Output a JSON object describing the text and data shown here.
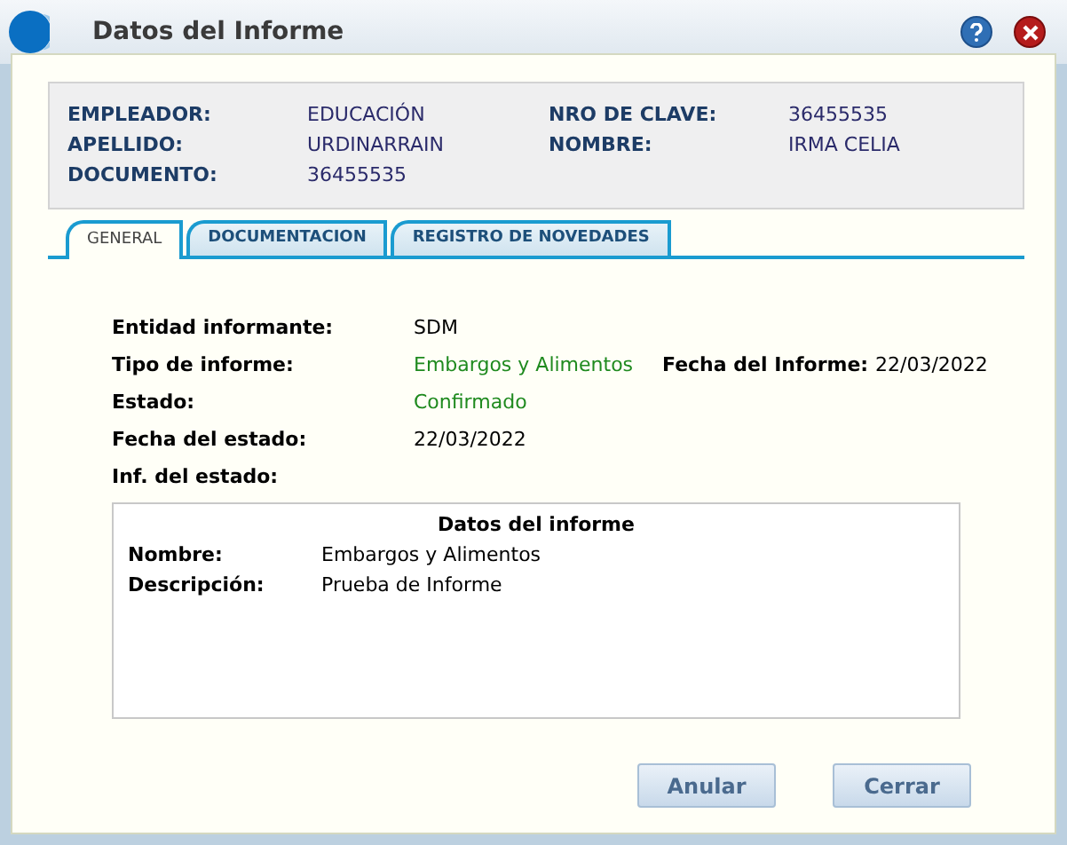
{
  "window": {
    "title": "Datos del Informe"
  },
  "header": [
    {
      "label": "EMPLEADOR:",
      "value": "EDUCACIÓN"
    },
    {
      "label": "NRO DE CLAVE:",
      "value": "36455535"
    },
    {
      "label": "APELLIDO:",
      "value": "URDINARRAIN"
    },
    {
      "label": "NOMBRE:",
      "value": "IRMA CELIA"
    },
    {
      "label": "DOCUMENTO:",
      "value": "36455535"
    }
  ],
  "tabs": [
    {
      "label": "GENERAL",
      "selected": true
    },
    {
      "label": "DOCUMENTACION",
      "selected": false
    },
    {
      "label": "REGISTRO DE NOVEDADES",
      "selected": false
    }
  ],
  "fields": [
    [
      {
        "label": "Entidad informante:",
        "value": "SDM",
        "color": "#000000"
      }
    ],
    [
      {
        "label": "Tipo de informe:",
        "value": "Embargos y Alimentos",
        "color": "#1f8a1f"
      },
      {
        "label": "Fecha del Informe:",
        "value": "22/03/2022",
        "color": "#000000"
      }
    ],
    [
      {
        "label": "Estado:",
        "value": "Confirmado",
        "color": "#1f8a1f"
      }
    ],
    [
      {
        "label": "Fecha del estado:",
        "value": "22/03/2022",
        "color": "#000000"
      }
    ],
    [
      {
        "label": "Inf. del estado:"
      }
    ]
  ],
  "details": {
    "title": "Datos del informe",
    "rows": [
      {
        "label": "Nombre:",
        "value": "Embargos y Alimentos"
      },
      {
        "label": "Descripción:",
        "value": "Prueba de Informe"
      }
    ]
  },
  "buttons": [
    "Anular",
    "Cerrar"
  ]
}
